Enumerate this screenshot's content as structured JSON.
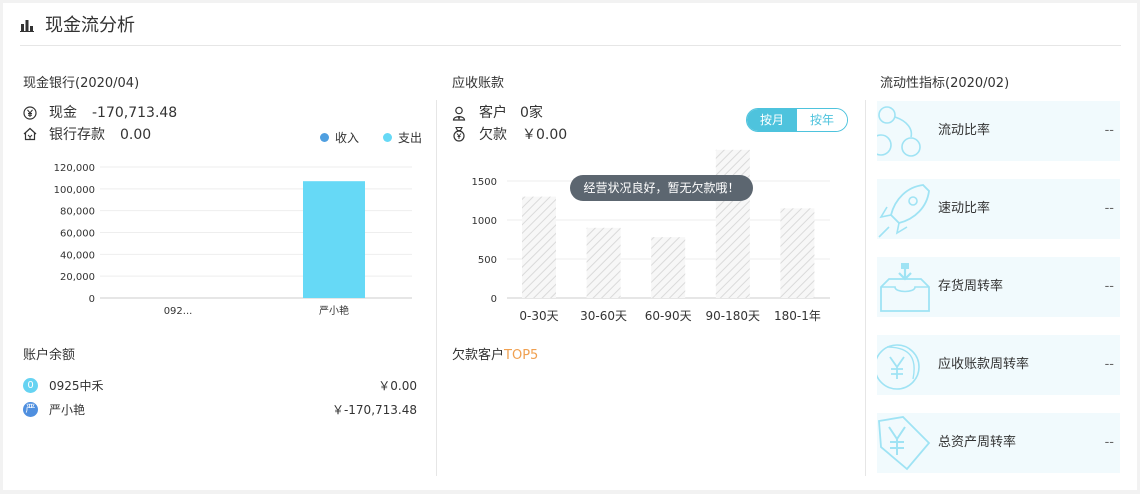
{
  "header": {
    "title": "现金流分析",
    "icon": "bar-chart-icon"
  },
  "cash_bank": {
    "title": "现金银行(2020/04)",
    "cash_label": "现金",
    "cash_value": "-170,713.48",
    "bank_label": "银行存款",
    "bank_value": "0.00",
    "legend_income": "收入",
    "legend_expense": "支出"
  },
  "receivables": {
    "title": "应收账款",
    "customer_label": "客户",
    "customer_value": "0家",
    "owed_label": "欠款",
    "owed_value": "￥0.00",
    "toggle_month": "按月",
    "toggle_year": "按年",
    "tooltip": "经营状况良好，暂无欠款哦！",
    "top5_prefix": "欠款客户",
    "top5_suffix": "TOP5"
  },
  "accounts": {
    "title": "账户余额",
    "items": [
      {
        "badge": "0",
        "name": "0925中禾",
        "value": "￥0.00"
      },
      {
        "badge": "严",
        "name": "严小艳",
        "value": "￥-170,713.48"
      }
    ]
  },
  "liquidity": {
    "title": "流动性指标(2020/02)",
    "items": [
      {
        "label": "流动比率",
        "value": "--",
        "icon": "bubbles-icon"
      },
      {
        "label": "速动比率",
        "value": "--",
        "icon": "rocket-icon"
      },
      {
        "label": "存货周转率",
        "value": "--",
        "icon": "inventory-box-icon"
      },
      {
        "label": "应收账款周转率",
        "value": "--",
        "icon": "yen-shield-icon"
      },
      {
        "label": "总资产周转率",
        "value": "--",
        "icon": "yen-tag-icon"
      }
    ]
  },
  "colors": {
    "income": "#4f9fe0",
    "expense": "#66d9f6",
    "accent": "#4ec3dd",
    "hatch": "#d9d9d9"
  },
  "chart_data": [
    {
      "type": "bar",
      "categories": [
        "092...",
        "严小艳"
      ],
      "series": [
        {
          "name": "收入",
          "values": [
            0,
            0
          ]
        },
        {
          "name": "支出",
          "values": [
            0,
            107000
          ]
        }
      ],
      "yticks": [
        "120,000",
        "100,000",
        "80,000",
        "60,000",
        "40,000",
        "20,000",
        "0"
      ],
      "ylim": [
        0,
        120000
      ],
      "legend": "top-right",
      "grid": true
    },
    {
      "type": "bar",
      "categories": [
        "0-30天",
        "30-60天",
        "60-90天",
        "90-180天",
        "180-1年"
      ],
      "values": [
        1300,
        900,
        780,
        1900,
        1150
      ],
      "yticks": [
        "1500",
        "1000",
        "500",
        "0"
      ],
      "ylim": [
        0,
        1900
      ],
      "grid": true,
      "placeholder": true
    }
  ]
}
